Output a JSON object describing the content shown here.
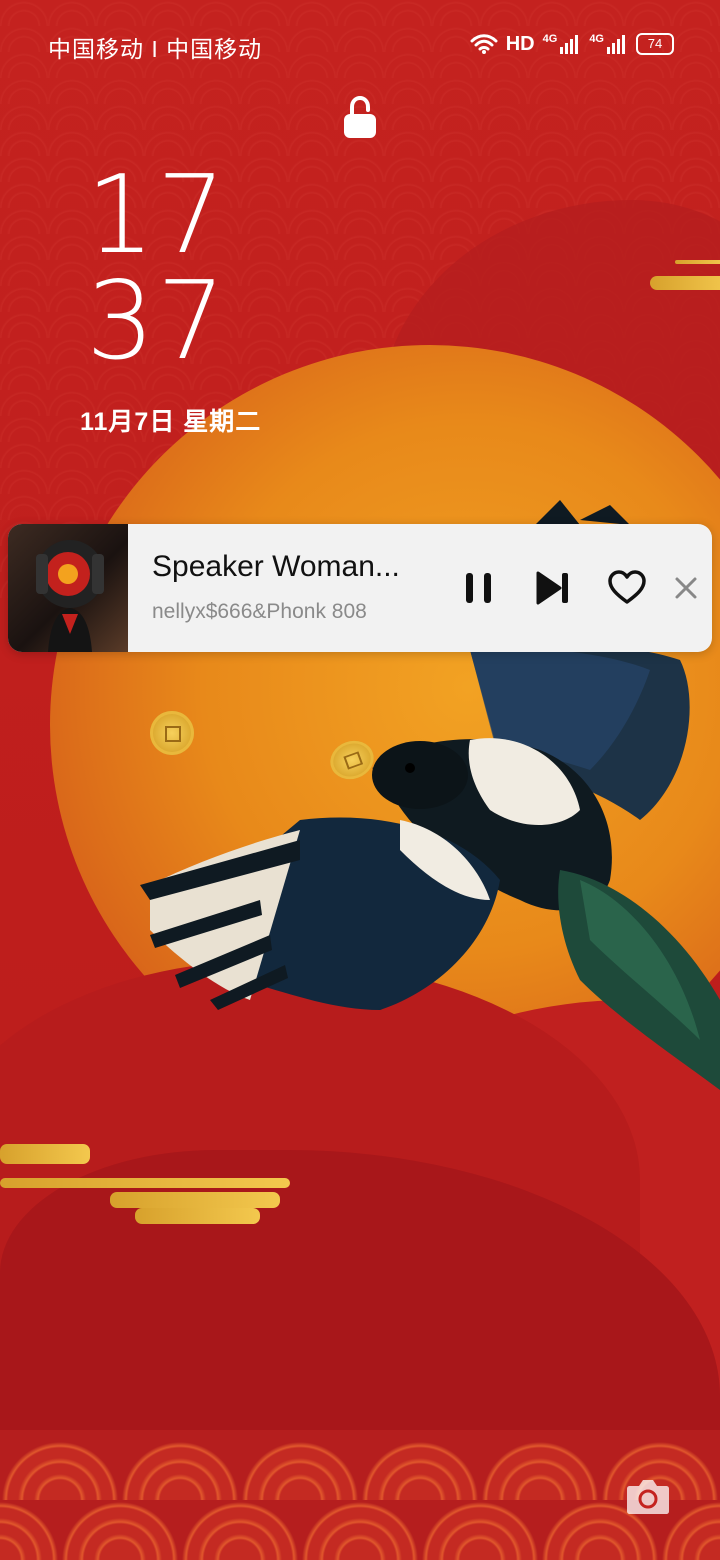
{
  "status_bar": {
    "carrier": "中国移动 I 中国移动",
    "hd_label": "HD",
    "network_1": "4G",
    "network_2": "4G",
    "battery": "74"
  },
  "clock": {
    "hours": "17",
    "minutes": "37",
    "date": "11月7日  星期二"
  },
  "music": {
    "title": "Speaker Woman...",
    "artist": "nellyx$666&Phonk 808"
  },
  "colors": {
    "background": "#c4221f",
    "sun": "#e8891a",
    "card": "#f2f2f2"
  },
  "icons": [
    "wifi-icon",
    "signal-icon",
    "battery-icon",
    "lock-icon",
    "pause-icon",
    "next-icon",
    "heart-icon",
    "close-icon",
    "camera-icon"
  ]
}
